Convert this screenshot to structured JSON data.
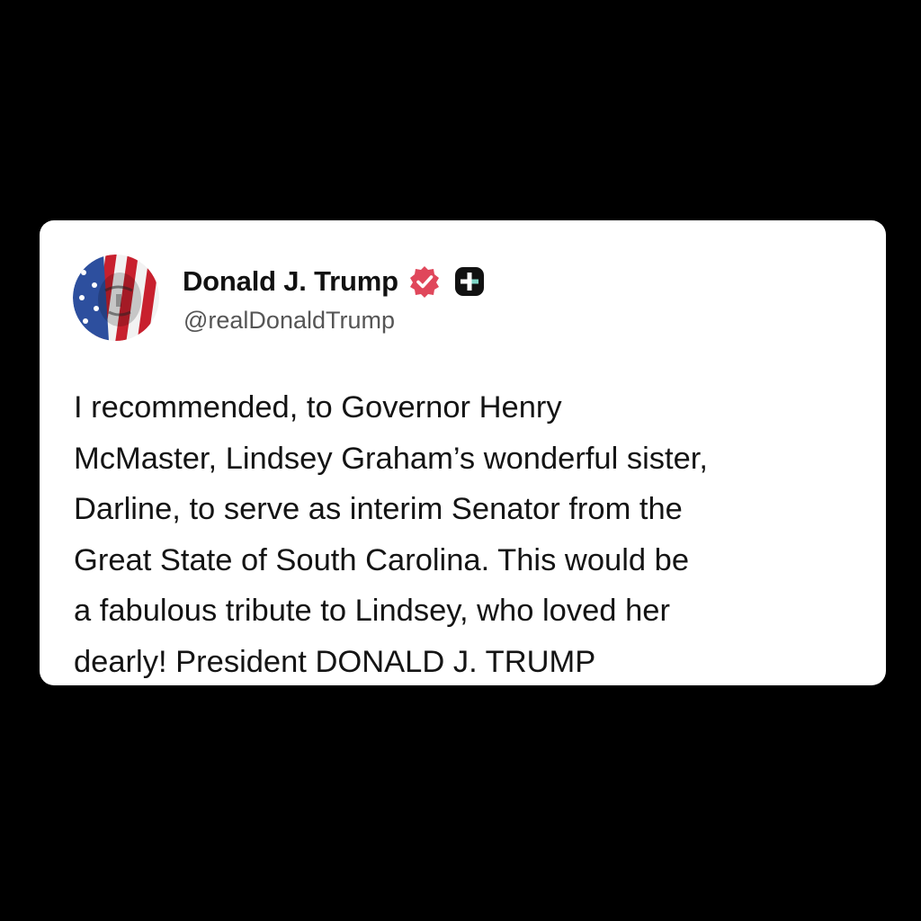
{
  "post": {
    "author": {
      "display_name": "Donald J. Trump",
      "handle": "@realDonaldTrump",
      "avatar_icon": "flag-portrait-avatar",
      "verified_icon": "verified-badge-icon",
      "verified_color": "#e0475b",
      "platform_icon": "truth-social-plus-icon",
      "platform_color": "#111111"
    },
    "body_lines": [
      "I recommended, to Governor Henry",
      "McMaster, Lindsey Graham’s wonderful sister,",
      "Darline, to serve as interim Senator from the",
      "Great State of South Carolina. This would be",
      "a fabulous tribute to Lindsey, who loved her",
      "dearly! President DONALD J. TRUMP"
    ]
  },
  "colors": {
    "background": "#000000",
    "card": "#ffffff",
    "text": "#141414",
    "handle": "#555555"
  }
}
